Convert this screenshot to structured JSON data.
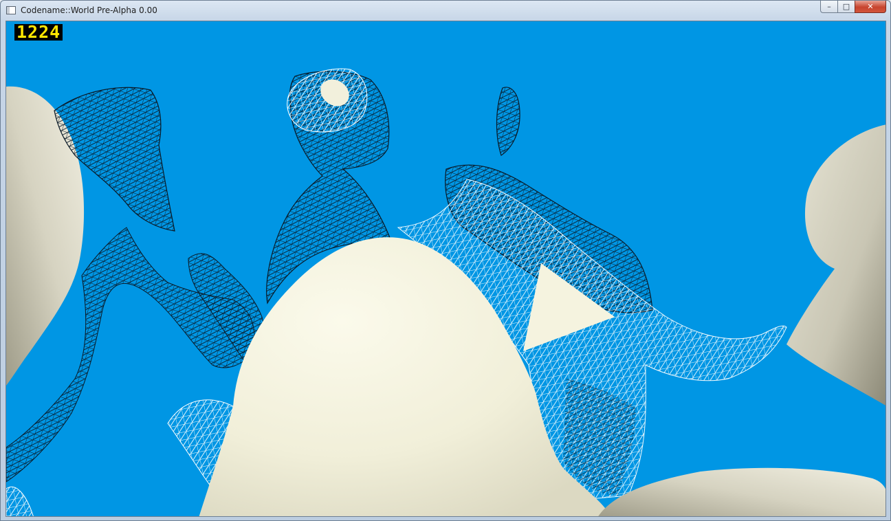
{
  "window": {
    "title": "Codename::World Pre-Alpha 0.00",
    "buttons": {
      "minimize_glyph": "–",
      "maximize_glyph": "□",
      "close_glyph": "✕"
    }
  },
  "hud": {
    "fps": "1224",
    "fps_color": "#ffe600"
  },
  "scene": {
    "sky_color": "#0096e4",
    "solid_color": "#f5f3df",
    "wire_dark_color": "#0a1a28",
    "wire_light_color": "#ffffff"
  }
}
